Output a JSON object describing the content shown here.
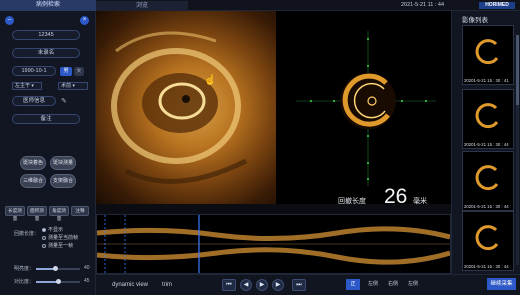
{
  "topbar": {
    "tab_case": "病例检索",
    "tab_view": "浏览",
    "datetime": "2021-5-21 11 : 44",
    "logo": "HORIMED"
  },
  "left_panel": {
    "patient_id": "12345",
    "patient_name": "未录名",
    "birth_date": "1990-10-1",
    "gender_male": "男",
    "gender_female": "女",
    "vessel_select": "左主干",
    "phase_select": "术前",
    "doctor_label": "医师信息",
    "note_label": "备注",
    "tool_buttons": [
      "斑块着色",
      "斑块测量",
      "三维融合",
      "支架融合"
    ],
    "func_buttons": [
      "长度测量",
      "面积测量",
      "角度测量",
      "注释"
    ],
    "pullback_label": "回撤长度：",
    "radio_options": [
      "不显示",
      "测量至当前帧",
      "测量至一帧"
    ],
    "brightness_label": "明亮度：",
    "brightness_value": "40",
    "brightness_level": 0.45,
    "contrast_label": "对比度：",
    "contrast_value": "45",
    "contrast_level": 0.5
  },
  "center": {
    "pullback_text": "回撤长度",
    "pullback_value": "26",
    "pullback_unit": "毫米"
  },
  "bottombar": {
    "view_mode": "dynamic view",
    "trim": "trim",
    "modes": [
      "正",
      "左侧",
      "右侧",
      "左侧"
    ],
    "save_button": "继续采集"
  },
  "right_panel": {
    "title": "影像列表",
    "thumbnails": [
      "20201-5-21 15 : 30 : 41",
      "20201-5-21 15 : 30 : 44",
      "20201-5-21 15 : 30 : 44",
      "20201-5-21 15 : 30 : 44"
    ]
  },
  "colors": {
    "accent": "#2c58c8",
    "background": "#0b0d12",
    "panel": "#121622"
  }
}
